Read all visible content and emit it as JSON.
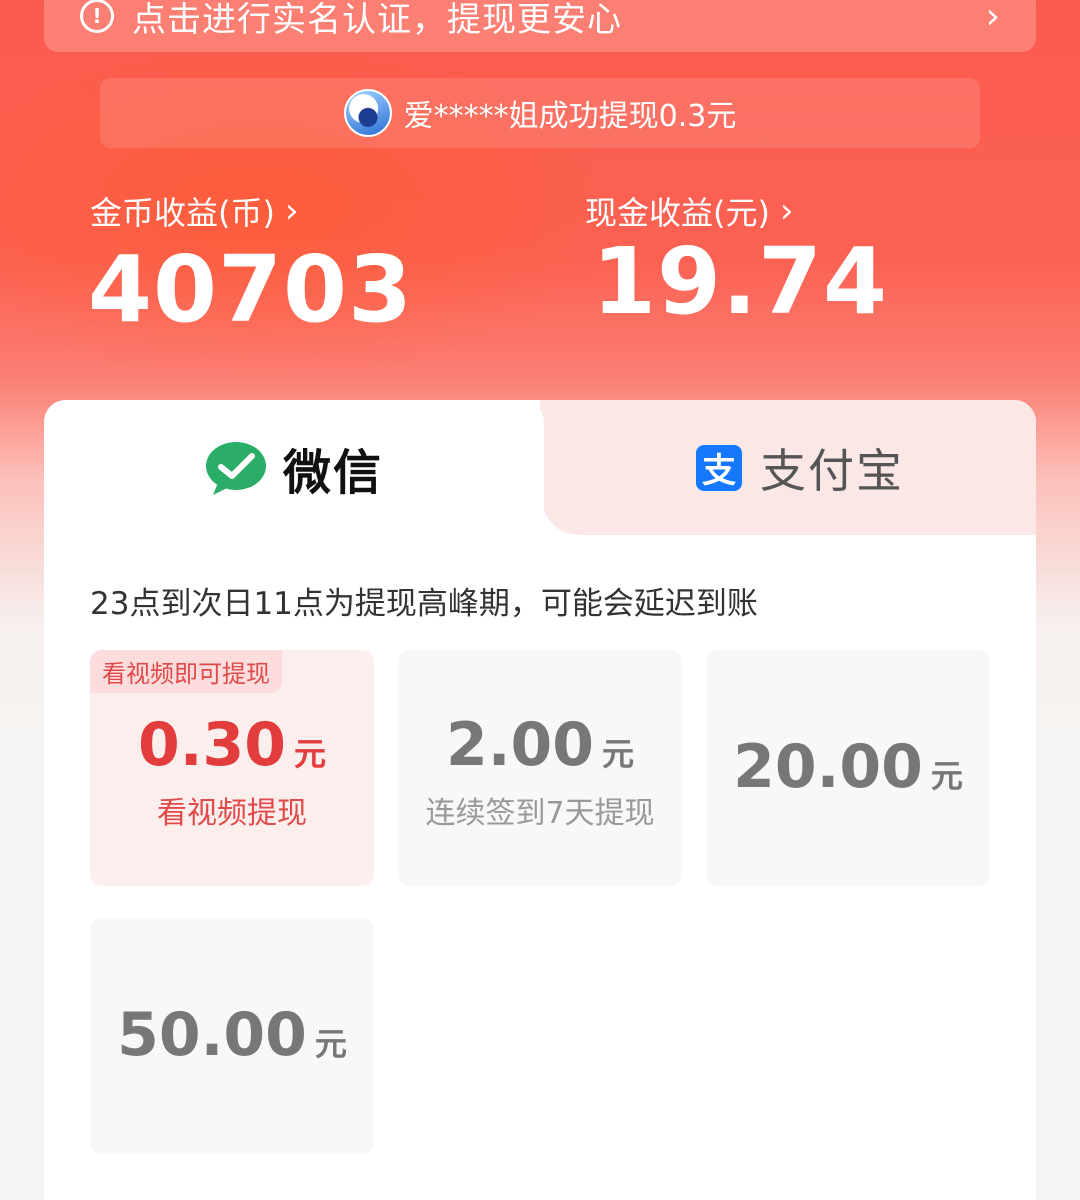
{
  "banner": {
    "text": "点击进行实名认证，提现更安心",
    "chevron": "›"
  },
  "ticker": {
    "text": "爱*****姐成功提现0.3元"
  },
  "earnings": {
    "coins": {
      "label": "金币收益(币)",
      "arrow": "›",
      "value": "40703"
    },
    "cash": {
      "label": "现金收益(元)",
      "arrow": "›",
      "value": "19.74"
    }
  },
  "tabs": {
    "wechat": {
      "label": "微信",
      "icon": "wechat-icon"
    },
    "alipay": {
      "label": "支付宝",
      "icon": "alipay-icon",
      "glyph": "支"
    }
  },
  "notice": "23点到次日11点为提现高峰期，可能会延迟到账",
  "options": [
    {
      "tag": "看视频即可提现",
      "amount": "0.30",
      "unit": "元",
      "sub": "看视频提现",
      "active": true
    },
    {
      "amount": "2.00",
      "unit": "元",
      "sub": "连续签到7天提现",
      "active": false
    },
    {
      "amount": "20.00",
      "unit": "元",
      "active": false
    },
    {
      "amount": "50.00",
      "unit": "元",
      "active": false
    }
  ],
  "colors": {
    "accent": "#e23c3c",
    "header": "#fb5b4d",
    "wechat": "#2aae67",
    "alipay": "#1677ff"
  }
}
